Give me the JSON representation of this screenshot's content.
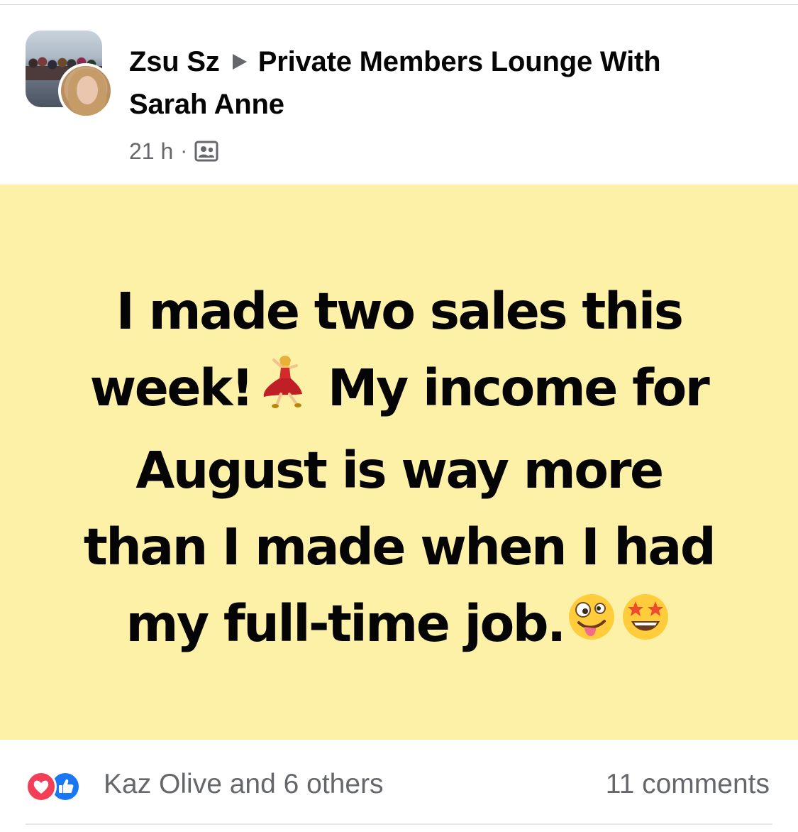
{
  "post": {
    "author": "Zsu Sz",
    "group_line1": "Private Members Lounge With",
    "group_line2": "Sarah Anne",
    "time": "21 h",
    "separator": "·",
    "audience_icon": "group-members-icon"
  },
  "content": {
    "background_color": "#fdf1a8",
    "line1": "I made two sales this",
    "line2_part1": "week!",
    "line2_part2": " My income for",
    "line3": "August is way more",
    "line4": "than I made when I had",
    "line5": "my full-time job.",
    "emojis": [
      "woman-dancing-emoji",
      "zany-face-emoji",
      "star-struck-emoji"
    ]
  },
  "footer": {
    "reactions": [
      "love-reaction-icon",
      "like-reaction-icon"
    ],
    "reactors": "Kaz Olive and 6 others",
    "comments": "11 comments"
  }
}
